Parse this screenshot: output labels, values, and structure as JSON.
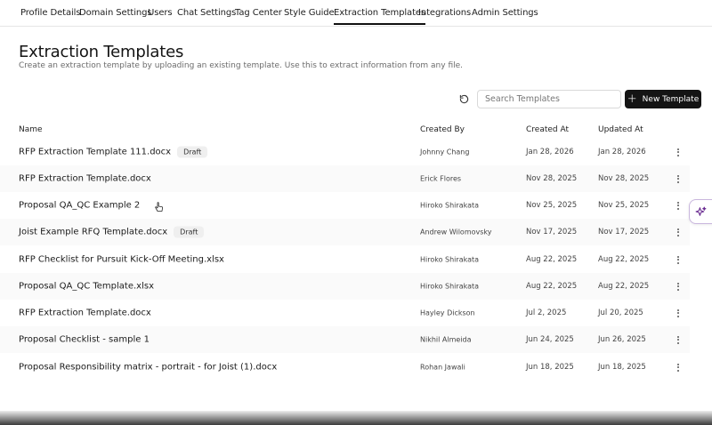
{
  "nav": {
    "tabs": [
      {
        "label": "Profile Details"
      },
      {
        "label": "Domain Settings"
      },
      {
        "label": "Users"
      },
      {
        "label": "Chat Settings"
      },
      {
        "label": "Tag Center"
      },
      {
        "label": "Style Guide"
      },
      {
        "label": "Extraction Templates",
        "active": true
      },
      {
        "label": "Integrations"
      },
      {
        "label": "Admin Settings"
      }
    ]
  },
  "page": {
    "title": "Extraction Templates",
    "subtitle": "Create an extraction template by uploading an existing template. Use this to extract information from any file."
  },
  "toolbar": {
    "search_placeholder": "Search Templates",
    "new_label": "New Template"
  },
  "table": {
    "headers": {
      "name": "Name",
      "created_by": "Created By",
      "created_at": "Created At",
      "updated_at": "Updated At"
    },
    "rows": [
      {
        "name": "RFP Extraction Template 111.docx",
        "badge": "Draft",
        "created_by": "Johnny Chang",
        "created_at": "Jan 28, 2026",
        "updated_at": "Jan 28, 2026"
      },
      {
        "name": "RFP Extraction Template.docx",
        "badge": "",
        "created_by": "Erick Flores",
        "created_at": "Nov 28, 2025",
        "updated_at": "Nov 28, 2025"
      },
      {
        "name": "Proposal QA_QC Example 2",
        "badge": "",
        "created_by": "Hiroko Shirakata",
        "created_at": "Nov 25, 2025",
        "updated_at": "Nov 25, 2025"
      },
      {
        "name": "Joist Example RFQ Template.docx",
        "badge": "Draft",
        "created_by": "Andrew Wilomovsky",
        "created_at": "Nov 17, 2025",
        "updated_at": "Nov 17, 2025"
      },
      {
        "name": "RFP Checklist for Pursuit Kick-Off Meeting.xlsx",
        "badge": "",
        "created_by": "Hiroko Shirakata",
        "created_at": "Aug 22, 2025",
        "updated_at": "Aug 22, 2025"
      },
      {
        "name": "Proposal QA_QC Template.xlsx",
        "badge": "",
        "created_by": "Hiroko Shirakata",
        "created_at": "Aug 22, 2025",
        "updated_at": "Aug 22, 2025"
      },
      {
        "name": "RFP Extraction Template.docx",
        "badge": "",
        "created_by": "Hayley Dickson",
        "created_at": "Jul 2, 2025",
        "updated_at": "Jul 20, 2025"
      },
      {
        "name": "Proposal Checklist - sample 1",
        "badge": "",
        "created_by": "Nikhil Almeida",
        "created_at": "Jun 24, 2025",
        "updated_at": "Jun 26, 2025"
      },
      {
        "name": "Proposal Responsibility matrix - portrait - for Joist (1).docx",
        "badge": "",
        "created_by": "Rohan Jawali",
        "created_at": "Jun 18, 2025",
        "updated_at": "Jun 18, 2025"
      }
    ]
  },
  "icons": {
    "refresh": "refresh-icon",
    "plus": "plus-icon",
    "more": "more-vertical-icon",
    "ai": "sparkle-icon"
  },
  "colors": {
    "primary_button": "#141414",
    "ai_border": "#c9b6dd",
    "ai_icon": "#6a2c91"
  }
}
